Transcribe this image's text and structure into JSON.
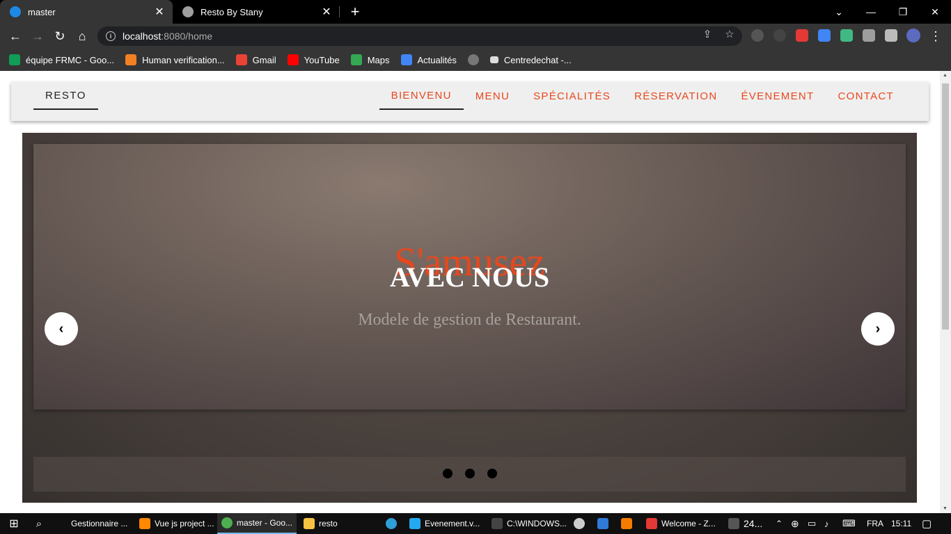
{
  "browser": {
    "tabs": [
      {
        "title": "master",
        "active": true
      },
      {
        "title": "Resto By Stany",
        "active": false
      }
    ],
    "new_tab": "+",
    "url_host": "localhost",
    "url_rest": ":8080/home",
    "bookmarks": [
      {
        "label": "équipe FRMC - Goo...",
        "color": "#0f9d58"
      },
      {
        "label": "Human verification...",
        "color": "#f48024"
      },
      {
        "label": "Gmail",
        "color": "#ea4335"
      },
      {
        "label": "YouTube",
        "color": "#ff0000"
      },
      {
        "label": "Maps",
        "color": "#34a853"
      },
      {
        "label": "Actualités",
        "color": "#4285f4"
      },
      {
        "label": "",
        "color": "#777777"
      },
      {
        "label": "Centredechat -...",
        "color": "#dddddd"
      }
    ]
  },
  "page": {
    "brand": "RESTO",
    "nav": [
      {
        "label": "BIENVENU",
        "active": true
      },
      {
        "label": "MENU",
        "active": false
      },
      {
        "label": "SPÉCIALITÉS",
        "active": false
      },
      {
        "label": "RÉSERVATION",
        "active": false
      },
      {
        "label": "ÉVENEMENT",
        "active": false
      },
      {
        "label": "CONTACT",
        "active": false
      }
    ],
    "hero": {
      "script_title": "S'amusez",
      "title": "AVEC NOUS",
      "subtitle": "Modele de gestion de Restaurant.",
      "prev": "‹",
      "next": "›",
      "slide_count": 3
    },
    "accent_color": "#e8471c"
  },
  "taskbar": {
    "items": [
      {
        "label": "Gestionnaire ...",
        "color": "#3c7bd6"
      },
      {
        "label": "Vue js project ...",
        "color": "#ff8800"
      },
      {
        "label": "master - Goo...",
        "color": "#4caf50"
      },
      {
        "label": "resto",
        "color": "#f5c242"
      },
      {
        "label": "",
        "color": "#2f9fd8"
      },
      {
        "label": "Evenement.v...",
        "color": "#23a9f2"
      },
      {
        "label": "C:\\WINDOWS...",
        "color": "#444444"
      },
      {
        "label": "",
        "color": "#cccccc"
      },
      {
        "label": "",
        "color": "#2f7bd6"
      },
      {
        "label": "",
        "color": "#f57c00"
      },
      {
        "label": "Welcome - Z...",
        "color": "#e53935"
      }
    ],
    "weather": "24...",
    "language": "FRA",
    "time": "15:11"
  }
}
